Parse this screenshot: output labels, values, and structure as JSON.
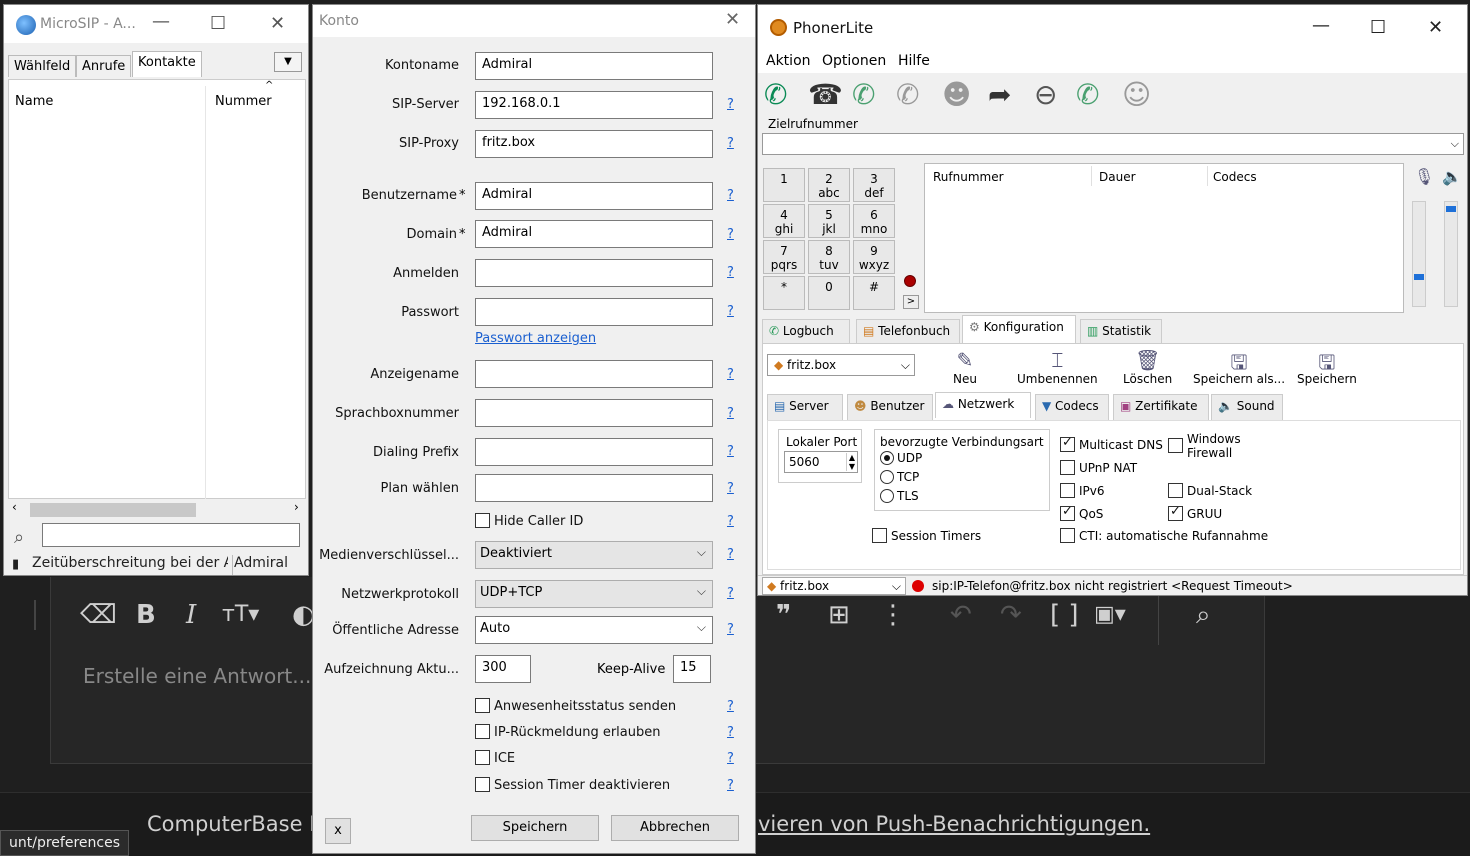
{
  "background": {
    "editor_placeholder": "Erstelle eine Antwort...",
    "footer_title": "ComputerBase F",
    "footer_link": "vieren von Push-Benachrichtigungen.",
    "status_url": "unt/preferences"
  },
  "microsip": {
    "title": "MicroSIP - A...",
    "tabs": [
      "Wählfeld",
      "Anrufe",
      "Kontakte"
    ],
    "active_tab": "Kontakte",
    "columns": [
      "Name",
      "Nummer"
    ],
    "status_text": "Zeitüberschreitung bei der A",
    "status_account": "Admiral"
  },
  "konto": {
    "title": "Konto",
    "fields": {
      "kontoname": {
        "label": "Kontoname",
        "value": "Admiral"
      },
      "sip_server": {
        "label": "SIP-Server",
        "value": "192.168.0.1"
      },
      "sip_proxy": {
        "label": "SIP-Proxy",
        "value": "fritz.box"
      },
      "benutzername": {
        "label": "Benutzername",
        "value": "Admiral"
      },
      "domain": {
        "label": "Domain",
        "value": "Admiral"
      },
      "anmelden": {
        "label": "Anmelden",
        "value": ""
      },
      "passwort": {
        "label": "Passwort",
        "value": ""
      },
      "anzeigename": {
        "label": "Anzeigename",
        "value": ""
      },
      "sprachbox": {
        "label": "Sprachboxnummer",
        "value": ""
      },
      "dialing_prefix": {
        "label": "Dialing Prefix",
        "value": ""
      },
      "plan": {
        "label": "Plan wählen",
        "value": ""
      },
      "medien": {
        "label": "Medienverschlüssel...",
        "value": "Deaktiviert"
      },
      "netzwerkprotokoll": {
        "label": "Netzwerkprotokoll",
        "value": "UDP+TCP"
      },
      "oeffentliche_adresse": {
        "label": "Öffentliche Adresse",
        "value": "Auto"
      },
      "aufzeichnung": {
        "label": "Aufzeichnung Aktu...",
        "value": "300"
      },
      "keep_alive": {
        "label": "Keep-Alive",
        "value": "15"
      }
    },
    "required_marker": "*",
    "show_password_link": "Passwort anzeigen",
    "help": "?",
    "checkboxes": {
      "hide_caller_id": "Hide Caller ID",
      "anwesenheit": "Anwesenheitsstatus senden",
      "ip_rueckmeldung": "IP-Rückmeldung erlauben",
      "ice": "ICE",
      "session_timer": "Session Timer deaktivieren"
    },
    "buttons": {
      "x": "x",
      "save": "Speichern",
      "cancel": "Abbrechen"
    }
  },
  "phoner": {
    "title": "PhonerLite",
    "menu": [
      "Aktion",
      "Optionen",
      "Hilfe"
    ],
    "ziel_label": "Zielrufnummer",
    "keypad": [
      {
        "d": "1",
        "l": ""
      },
      {
        "d": "2",
        "l": "abc"
      },
      {
        "d": "3",
        "l": "def"
      },
      {
        "d": "4",
        "l": "ghi"
      },
      {
        "d": "5",
        "l": "jkl"
      },
      {
        "d": "6",
        "l": "mno"
      },
      {
        "d": "7",
        "l": "pqrs"
      },
      {
        "d": "8",
        "l": "tuv"
      },
      {
        "d": "9",
        "l": "wxyz"
      },
      {
        "d": "*",
        "l": ""
      },
      {
        "d": "0",
        "l": ""
      },
      {
        "d": "#",
        "l": ""
      }
    ],
    "expand": ">",
    "call_columns": [
      "Rufnummer",
      "Dauer",
      "Codecs"
    ],
    "tabs": [
      "Logbuch",
      "Telefonbuch",
      "Konfiguration",
      "Statistik"
    ],
    "active_tab": "Konfiguration",
    "account_select": "fritz.box",
    "actions": [
      "Neu",
      "Umbenennen",
      "Löschen",
      "Speichern als...",
      "Speichern"
    ],
    "subtabs": [
      "Server",
      "Benutzer",
      "Netzwerk",
      "Codecs",
      "Zertifikate",
      "Sound"
    ],
    "active_subtab": "Netzwerk",
    "network": {
      "local_port_label": "Lokaler Port",
      "local_port": "5060",
      "pref_conn_label": "bevorzugte Verbindungsart",
      "radios": [
        "UDP",
        "TCP",
        "TLS"
      ],
      "selected_radio": "UDP",
      "session_timers": "Session Timers",
      "multicast_dns": "Multicast DNS",
      "windows_firewall_1": "Windows",
      "windows_firewall_2": "Firewall",
      "upnp_nat": "UPnP NAT",
      "ipv6": "IPv6",
      "dual_stack": "Dual-Stack",
      "qos": "QoS",
      "gruu": "GRUU",
      "cti": "CTI: automatische Rufannahme"
    },
    "status_account": "fritz.box",
    "status_text": "sip:IP-Telefon@fritz.box nicht registriert <Request Timeout>"
  }
}
